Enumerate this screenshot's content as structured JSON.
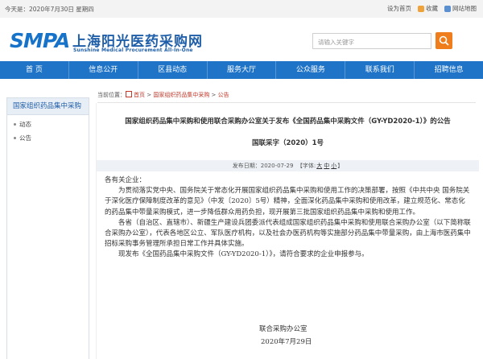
{
  "topbar": {
    "date": "今天是：2020年7月30日 星期四",
    "set_home": "设为首页",
    "favorite": "收藏",
    "site_map": "网站地图"
  },
  "header": {
    "logo_abbr": "SMPA",
    "logo_cn": "上海阳光医药采购网",
    "logo_en": "Sunshine Medical Procurement All-In-One",
    "search_placeholder": "请输入关键字"
  },
  "nav": [
    "首 页",
    "信息公开",
    "区县动态",
    "服务大厅",
    "公众服务",
    "联系我们",
    "招聘信息"
  ],
  "sidebar": {
    "title": "国家组织药品集中采购",
    "items": [
      {
        "label": "动态"
      },
      {
        "label": "公告"
      }
    ]
  },
  "breadcrumb": {
    "prefix": "当前位置：",
    "home": "首页",
    "sep": " > ",
    "section": "国家组织药品集中采购",
    "page": "公告"
  },
  "article": {
    "title": "国家组织药品集中采购和使用联合采购办公室关于发布《全国药品集中采购文件（GY-YD2020-1）》的公告",
    "doc_no": "国联采字（2020）1号",
    "publish_label": "发布日期：",
    "publish_date": "2020-07-29",
    "font_label_open": "【字体:",
    "font_large": "大",
    "font_medium": "中",
    "font_small": "小",
    "font_label_close": "】",
    "salutation": "各有关企业：",
    "paragraphs": [
      "为贯彻落实党中央、国务院关于常态化开展国家组织药品集中采购和使用工作的决策部署，按照《中共中央 国务院关于深化医疗保障制度改革的意见》（中发〔2020〕5号）精神，全面深化药品集中采购和使用改革，建立规范化、常态化的药品集中带量采购模式，进一步降低群众用药负担，现开展第三批国家组织药品集中采购和使用工作。",
      "各省（自治区、直辖市）、新疆生产建设兵团委派代表组成国家组织药品集中采购和使用联合采购办公室（以下简称联合采购办公室），代表各地区公立、军队医疗机构，以及社会办医药机构等实施部分药品集中带量采购，由上海市医药集中招标采购事务管理所承担日常工作并具体实施。",
      "现发布《全国药品集中采购文件（GY-YD2020-1）》，请符合要求的企业申报参与。"
    ],
    "signature": "联合采购办公室",
    "sign_date": "2020年7月29日"
  },
  "colors": {
    "nav_bg": "#1f74c8",
    "logo_blue": "#1773c9",
    "search_btn": "#f07d1b",
    "breadcrumb_red": "#c0392b"
  }
}
